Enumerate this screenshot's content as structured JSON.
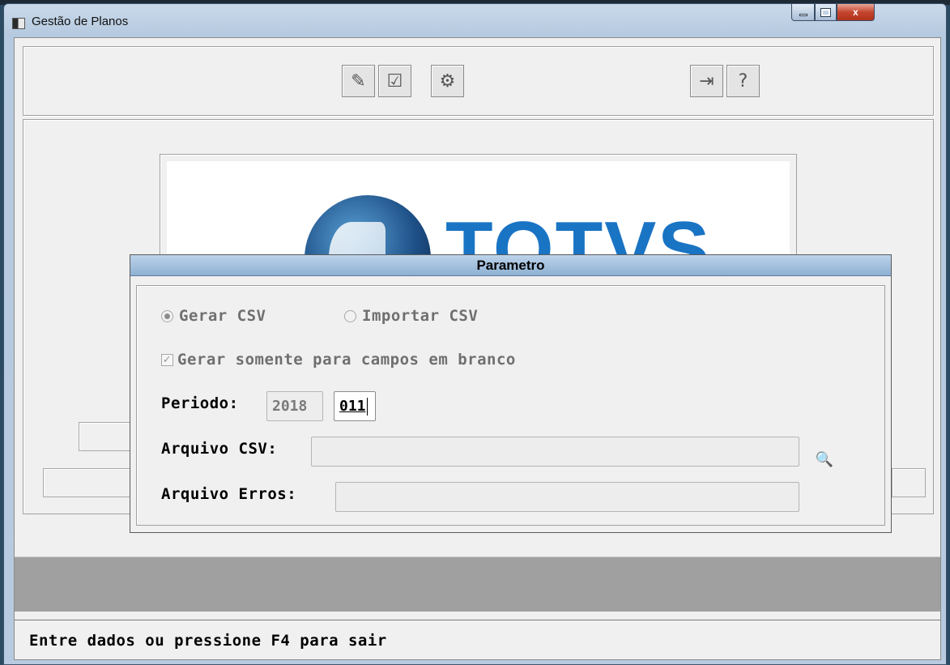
{
  "window": {
    "title": "Gestão de Planos",
    "controls": {
      "minimize": "minimize",
      "maximize": "maximize",
      "close": "x"
    }
  },
  "toolbar": {
    "buttons": [
      {
        "name": "tool-edit-button",
        "icon": "✎"
      },
      {
        "name": "tool-list-button",
        "icon": "☑"
      },
      {
        "name": "tool-settings-button",
        "icon": "⚙"
      },
      {
        "name": "tool-exit-button",
        "icon": "⇥"
      },
      {
        "name": "tool-help-button",
        "icon": "?"
      }
    ]
  },
  "logo": {
    "text": "TOTVS"
  },
  "dialog": {
    "title": "Parametro",
    "options": {
      "gerar_csv": "Gerar CSV",
      "importar_csv": "Importar CSV",
      "selected": "gerar_csv"
    },
    "checkbox": {
      "label": "Gerar somente para campos em branco",
      "checked": true
    },
    "periodo": {
      "label": "Periodo:",
      "year": "2018",
      "month": "011"
    },
    "arquivo_csv": {
      "label": "Arquivo CSV:",
      "value": ""
    },
    "arquivo_erros": {
      "label": "Arquivo Erros:",
      "value": ""
    }
  },
  "status": {
    "message": "Entre dados ou pressione F4 para sair"
  }
}
